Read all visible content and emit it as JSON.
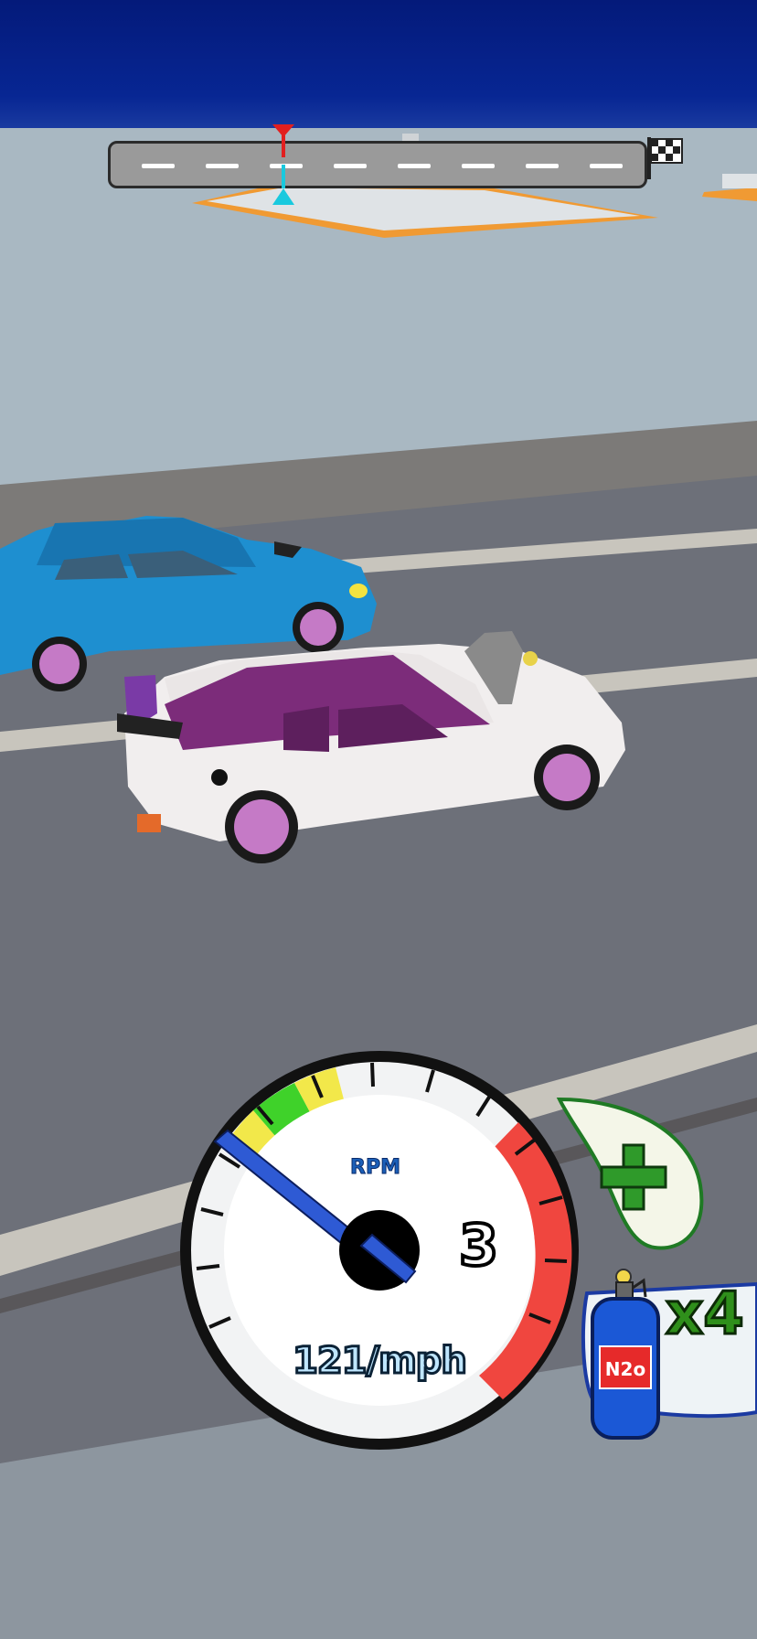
{
  "hud": {
    "progress_track": {
      "progress": 0.3,
      "finish_icon": "checkered-flag-icon"
    },
    "speedometer": {
      "rpm_label": "RPM",
      "gear": "3",
      "speed": "121/mph",
      "needle_level": 0.16,
      "zones": [
        "yellow",
        "green",
        "yellow",
        "white",
        "red"
      ]
    },
    "add_button": {
      "icon": "plus-icon",
      "color": "#2f9a2a"
    },
    "nitro": {
      "label": "N2o",
      "count": "x4",
      "icon": "nitro-bottle-icon",
      "color": "#1b58d6"
    }
  },
  "colors": {
    "top_bar": "#072693",
    "road": "#6d7079",
    "player_car": "#f1eeee",
    "player_car_accent": "#7c2c7a",
    "rival_car": "#1e8fd0",
    "rim": "#c57ac6",
    "redline": "#f0463f"
  }
}
